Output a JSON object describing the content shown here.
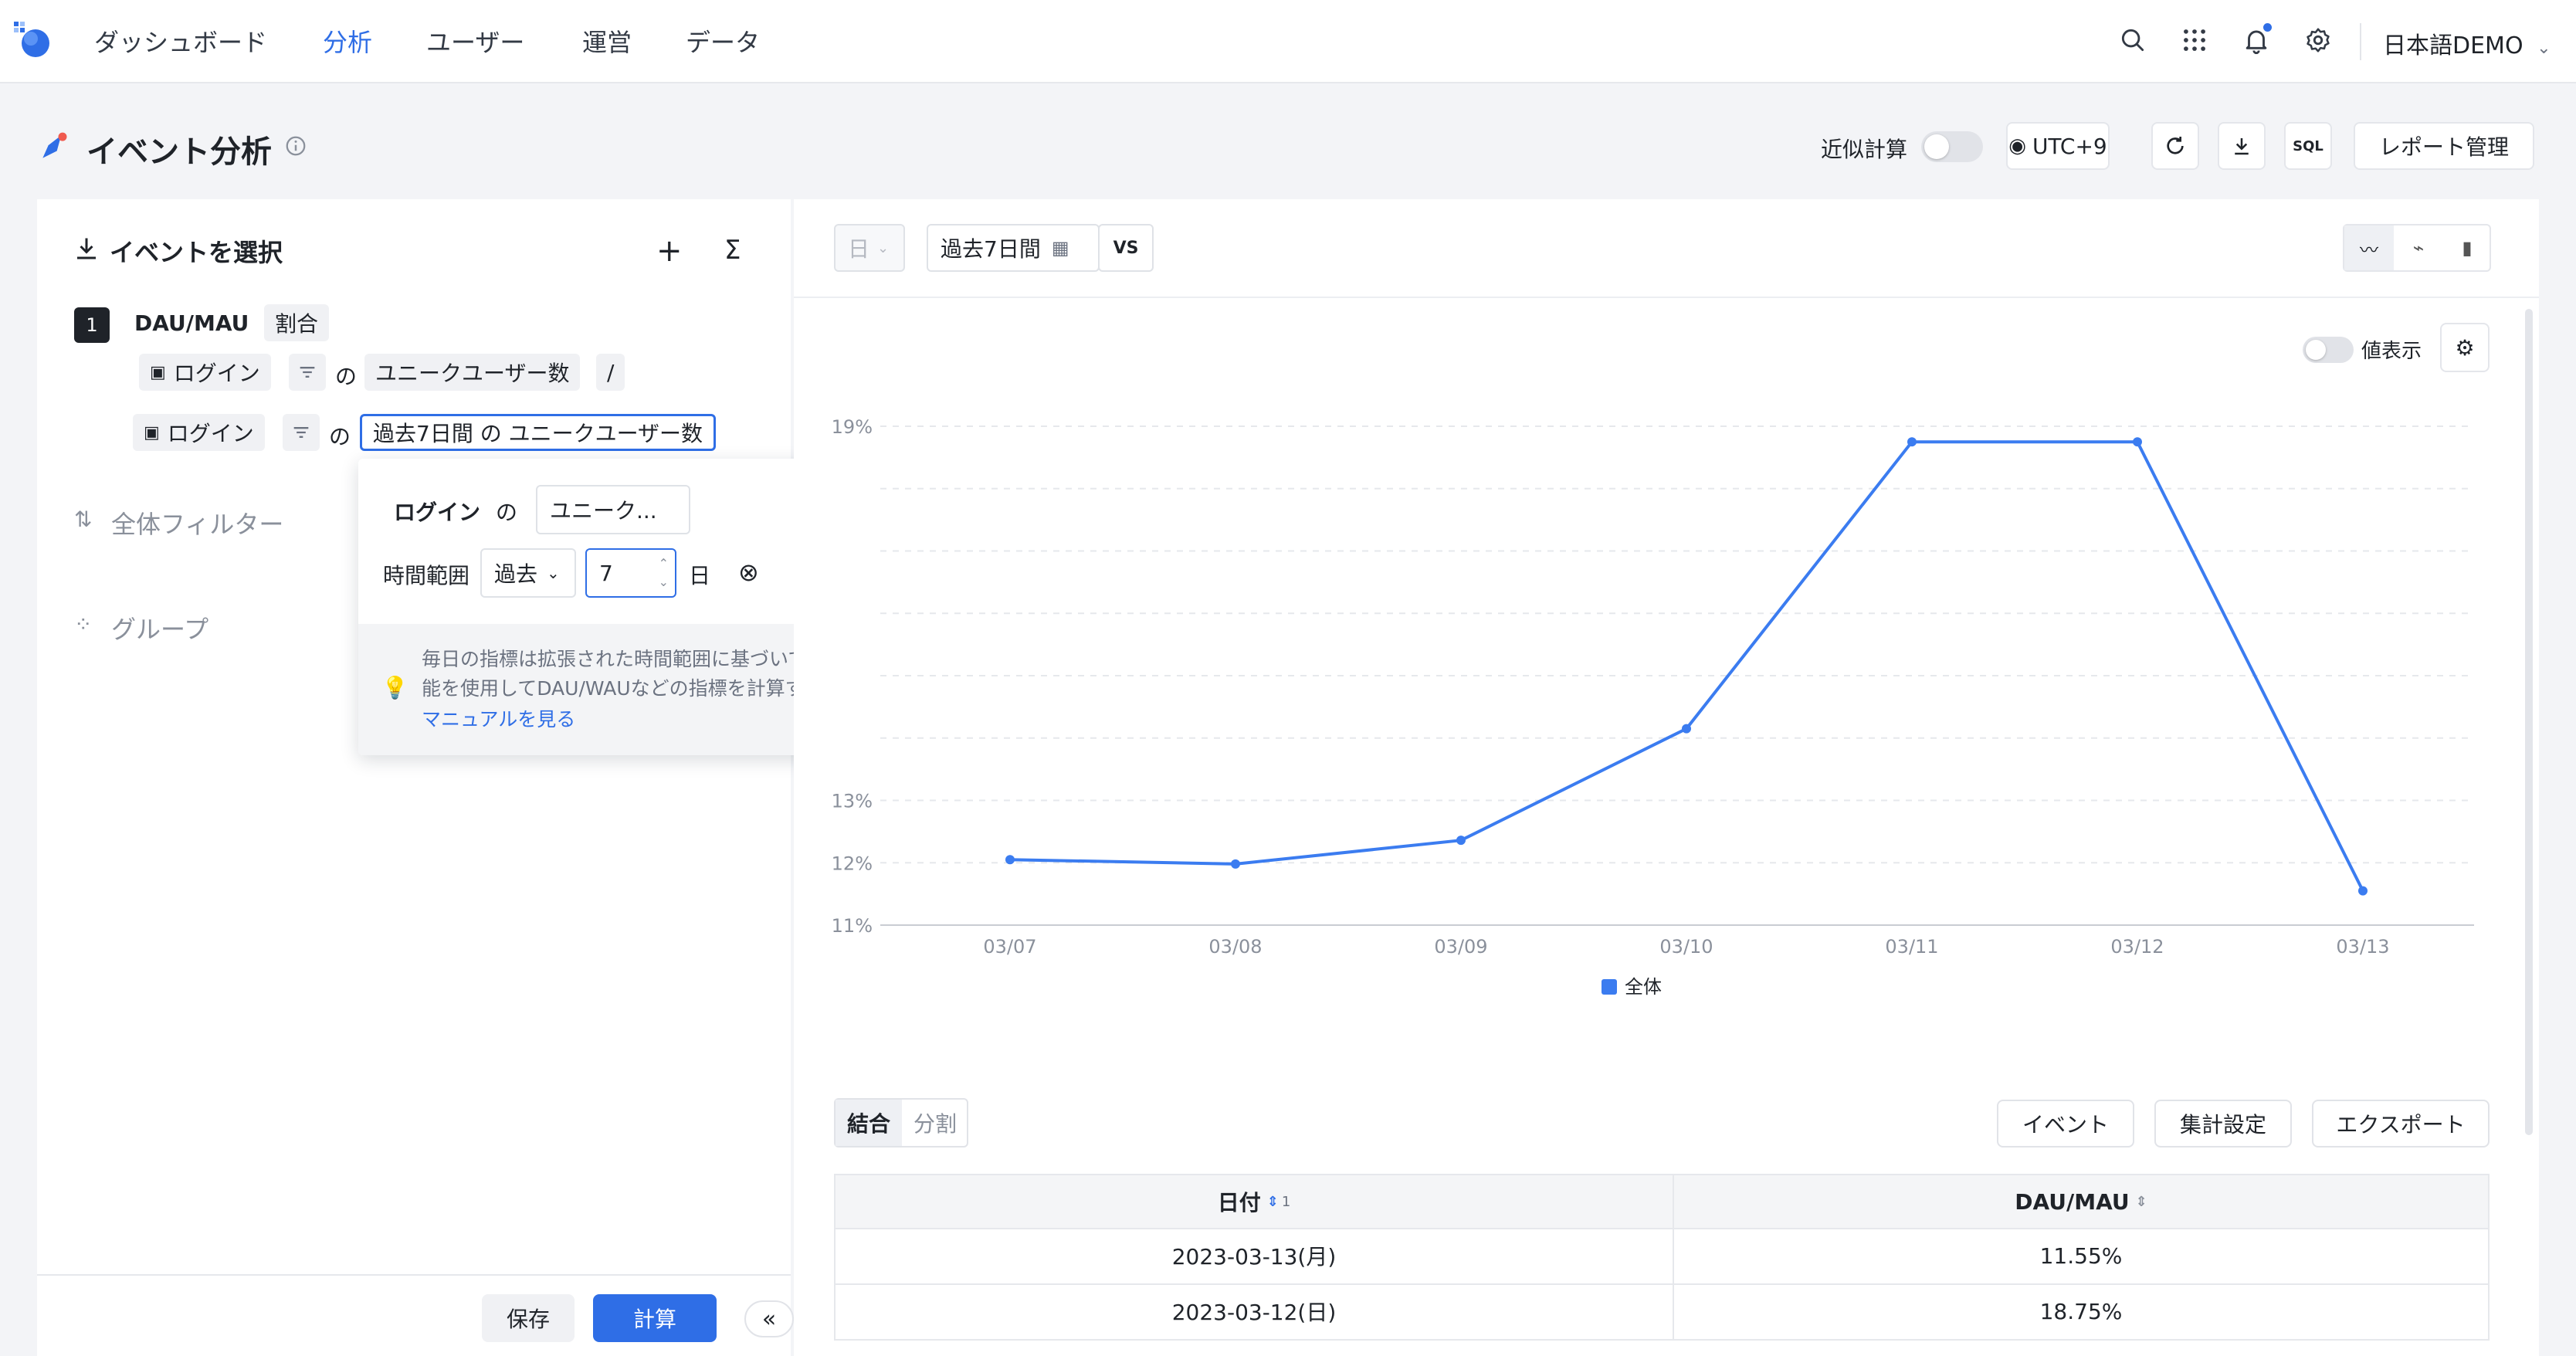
{
  "nav": {
    "items": [
      "ダッシュボード",
      "分析",
      "ユーザー",
      "運営",
      "データ"
    ],
    "active_index": 1,
    "user_label": "日本語DEMO"
  },
  "header": {
    "title": "イベント分析",
    "approx_label": "近似計算",
    "approx_enabled": false,
    "timezone": "UTC+9",
    "sql_label": "SQL",
    "report_button": "レポート管理"
  },
  "left": {
    "select_events_title": "イベントを選択",
    "metric_index": "1",
    "metric_name": "DAU/MAU",
    "metric_type": "割合",
    "row1": {
      "event": "ログイン",
      "of": "の",
      "measure": "ユニークユーザー数",
      "op": "/"
    },
    "row2": {
      "event": "ログイン",
      "of": "の",
      "measure": "過去7日間 の ユニークユーザー数"
    },
    "global_filter_title": "全体フィルター",
    "group_title": "グループ",
    "save_button": "保存",
    "calc_button": "計算"
  },
  "popover": {
    "event_label": "ログイン",
    "of": "の",
    "measure_short": "ユニーク...",
    "range_label": "時間範囲",
    "range_mode": "過去",
    "range_value": "7",
    "range_unit": "日",
    "note_line1": "毎日の指標は拡張された時間範囲に基づいて計算され、この機",
    "note_line2": "能を使用してDAU/WAUなどの指標を計算することはできます。",
    "manual_link": "マニュアルを見る"
  },
  "toolbar": {
    "granularity": "日",
    "date_range": "過去7日間",
    "vs_label": "VS",
    "show_values_label": "値表示",
    "show_values_enabled": false
  },
  "colors": {
    "accent": "#2f6ee6",
    "line": "#3b7cf0"
  },
  "chart_data": {
    "type": "line",
    "x": [
      "03/07",
      "03/08",
      "03/09",
      "03/10",
      "03/11",
      "03/12",
      "03/13"
    ],
    "series": [
      {
        "name": "全体",
        "values": [
          12.05,
          11.98,
          12.36,
          14.15,
          18.75,
          18.75,
          11.55
        ]
      }
    ],
    "y_ticks": [
      "19%",
      "13%",
      "12%",
      "11%"
    ],
    "ylim": [
      11,
      19
    ],
    "grid": true,
    "legend": "bottom-center"
  },
  "table": {
    "tabs": [
      "結合",
      "分割"
    ],
    "active_tab": 0,
    "actions": [
      "イベント",
      "集計設定",
      "エクスポート"
    ],
    "columns": [
      "日付",
      "DAU/MAU"
    ],
    "sort_badge": "1",
    "rows": [
      [
        "2023-03-13(月)",
        "11.55%"
      ],
      [
        "2023-03-12(日)",
        "18.75%"
      ]
    ]
  }
}
